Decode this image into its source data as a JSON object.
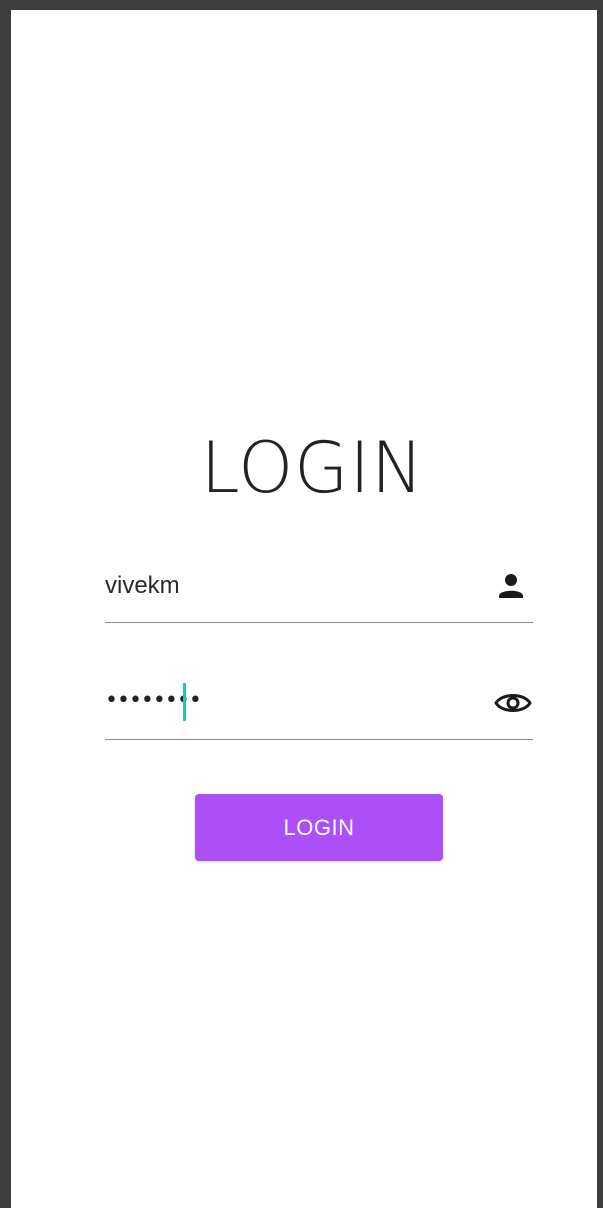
{
  "login_screen": {
    "title": "LOGIN",
    "username_field": {
      "value": "vivekm",
      "icon": "person-icon"
    },
    "password_field": {
      "masked_value": "••••••••",
      "icon": "eye-icon"
    },
    "login_button_label": "LOGIN"
  },
  "colors": {
    "accent": "#ad4ff6",
    "caret": "#26c2b5",
    "frame": "#3d3d3d"
  }
}
